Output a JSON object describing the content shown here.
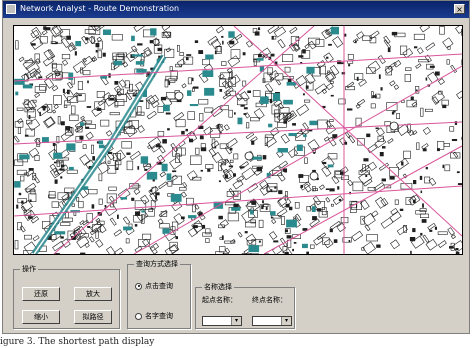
{
  "window": {
    "title": "Network Analyst - Route Demonstration",
    "close_glyph": "×"
  },
  "map": {
    "background": "#ffffff",
    "block_color": "#1f1f1f",
    "water_color": "#2a8a8e",
    "route_color": "#d9549a"
  },
  "operations": {
    "legend": "操作",
    "restore_label": "还原",
    "zoom_in_label": "放大",
    "zoom_out_label": "缩小",
    "pan_label": "拟路径"
  },
  "query_mode": {
    "legend": "查询方式选择",
    "options": [
      "点击查询",
      "名字查询"
    ],
    "selected": "点击查询"
  },
  "name_select": {
    "legend": "名称选择",
    "start_label": "起点名称：",
    "end_label": "终点名称：",
    "arrow_glyph": "▾"
  },
  "caption": "igure 3. The shortest path display"
}
